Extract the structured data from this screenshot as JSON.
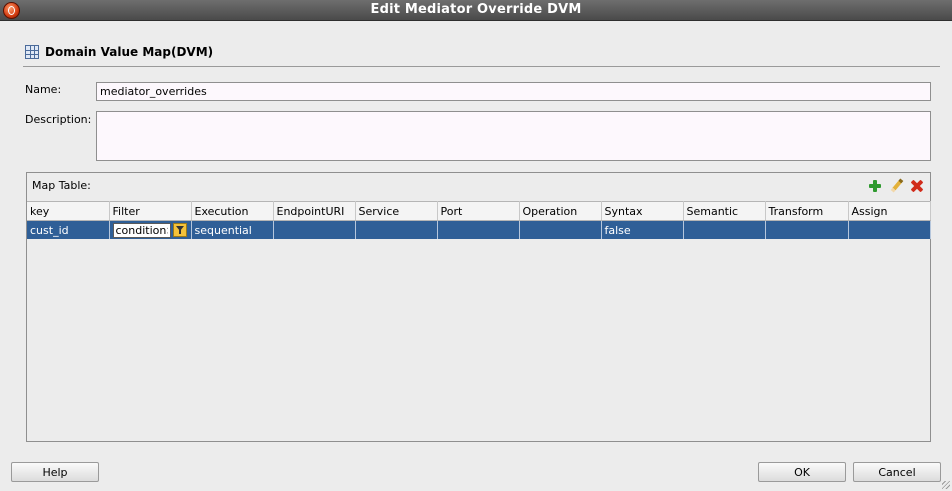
{
  "window": {
    "title": "Edit Mediator Override DVM"
  },
  "header": {
    "title": "Domain Value Map(DVM)",
    "icon": "table-grid-icon"
  },
  "form": {
    "name_label": "Name:",
    "name_value": "mediator_overrides",
    "description_label": "Description:",
    "description_value": ""
  },
  "map_table": {
    "label": "Map Table:",
    "toolbar": [
      "add-icon",
      "edit-icon",
      "delete-icon"
    ],
    "columns": [
      "key",
      "Filter",
      "Execution",
      "EndpointURI",
      "Service",
      "Port",
      "Operation",
      "Syntax",
      "Semantic",
      "Transform",
      "Assign"
    ],
    "rows": [
      {
        "key": "cust_id",
        "filter": "condition>",
        "execution": "sequential",
        "endpoint": "",
        "service": "",
        "port": "",
        "operation": "",
        "syntax": "false",
        "semantic": "",
        "transform": "",
        "assign": ""
      }
    ],
    "selection_color": "#2f5f97"
  },
  "buttons": {
    "help": "Help",
    "ok": "OK",
    "cancel": "Cancel"
  }
}
